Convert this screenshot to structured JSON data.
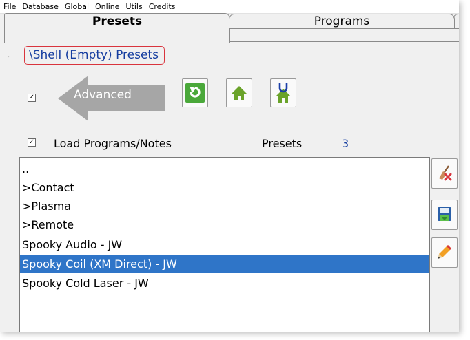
{
  "menu": [
    "File",
    "Database",
    "Global",
    "Online",
    "Utils",
    "Credits"
  ],
  "tabs": {
    "presets": "Presets",
    "programs": "Programs"
  },
  "group": {
    "title": "\\Shell (Empty) Presets"
  },
  "advanced": {
    "label": "Advanced",
    "checked": "✓"
  },
  "load": {
    "label": "Load Programs/Notes",
    "checked": "✓"
  },
  "presets_count": {
    "label": "Presets",
    "value": "3"
  },
  "list": {
    "items": [
      "..",
      ">Contact",
      ">Plasma",
      ">Remote",
      "Spooky Audio - JW",
      "Spooky Coil (XM Direct) - JW",
      "Spooky Cold Laser - JW"
    ],
    "selected_index": 5
  },
  "icons": {
    "refresh": "refresh-icon",
    "home": "home-icon",
    "home_u": "home-u-icon",
    "clear": "broom-clear-icon",
    "save": "save-icon",
    "edit": "pencil-icon"
  },
  "colors": {
    "selection": "#2f75c8",
    "title_text": "#163ea0",
    "title_border": "#d9343d",
    "accent_green": "#4aa83a",
    "arrow_gray": "#a6a6a6"
  }
}
